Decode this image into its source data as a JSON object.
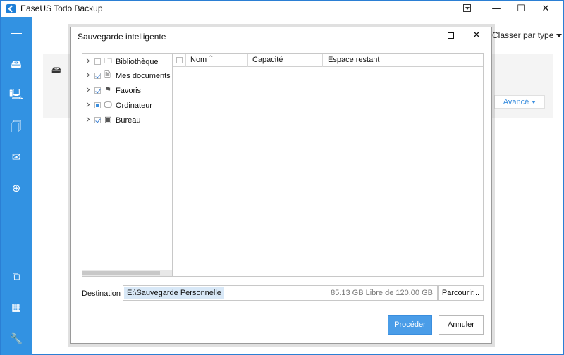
{
  "app": {
    "title": "EaseUS Todo Backup",
    "accent_color": "#3292e2"
  },
  "window_controls": {
    "minimize": "—",
    "maximize": "☐",
    "close": "✕"
  },
  "sidebar": {
    "icons": [
      "menu-icon",
      "disk-backup-icon",
      "system-backup-icon",
      "file-backup-icon",
      "mail-backup-icon",
      "smart-backup-icon",
      "clone-icon",
      "apps-icon",
      "tools-icon"
    ]
  },
  "background": {
    "sort_label": "Classer par type",
    "advanced_label": "Avancé"
  },
  "dialog": {
    "title": "Sauvegarde intelligente",
    "tree": [
      {
        "label": "Bibliothèque",
        "state": "unchecked",
        "icon": "folder-icon"
      },
      {
        "label": "Mes documents",
        "state": "checked",
        "icon": "document-icon"
      },
      {
        "label": "Favoris",
        "state": "checked",
        "icon": "favorites-icon"
      },
      {
        "label": "Ordinateur",
        "state": "partial",
        "icon": "computer-icon"
      },
      {
        "label": "Bureau",
        "state": "checked",
        "icon": "desktop-icon"
      }
    ],
    "columns": {
      "name": "Nom",
      "capacity": "Capacité",
      "remaining": "Espace restant"
    },
    "destination": {
      "label": "Destination",
      "value": "E:\\Sauvegarde Personnelle",
      "free_space": "85.13 GB Libre de 120.00 GB",
      "browse_label": "Parcourir..."
    },
    "buttons": {
      "proceed": "Procéder",
      "cancel": "Annuler"
    }
  }
}
